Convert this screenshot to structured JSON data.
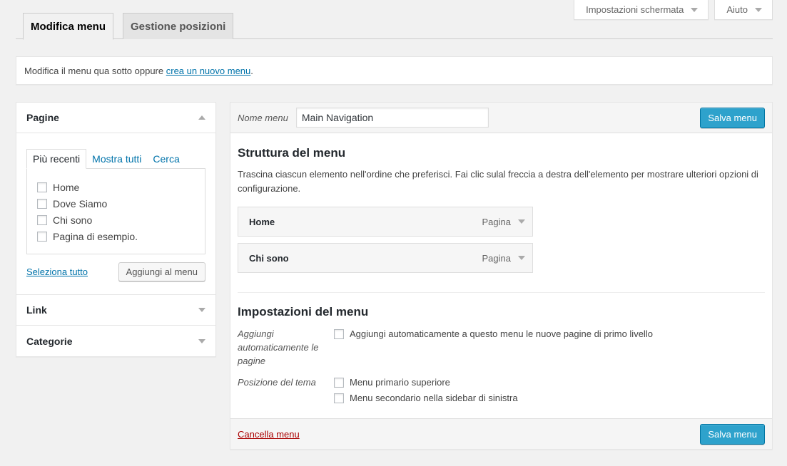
{
  "screen_options": {
    "screen_settings_label": "Impostazioni schermata",
    "help_label": "Aiuto"
  },
  "tabs": {
    "edit_menu": "Modifica menu",
    "manage_locations": "Gestione posizioni"
  },
  "notice": {
    "text": "Modifica il menu qua sotto oppure ",
    "link": "crea un nuovo menu",
    "after": "."
  },
  "sidebar": {
    "pages": {
      "title": "Pagine",
      "tabs": [
        "Più recenti",
        "Mostra tutti",
        "Cerca"
      ],
      "items": [
        "Home",
        "Dove Siamo",
        "Chi sono",
        "Pagina di esempio."
      ],
      "select_all": "Seleziona tutto",
      "add_button": "Aggiungi al menu"
    },
    "links_title": "Link",
    "categories_title": "Categorie"
  },
  "menu": {
    "name_label": "Nome menu",
    "name_value": "Main Navigation",
    "save_label": "Salva menu",
    "structure_title": "Struttura del menu",
    "structure_desc": "Trascina ciascun elemento nell'ordine che preferisci. Fai clic sulal freccia a destra dell'elemento per mostrare ulteriori opzioni di configurazione.",
    "items": [
      {
        "title": "Home",
        "type": "Pagina"
      },
      {
        "title": "Chi sono",
        "type": "Pagina"
      }
    ],
    "settings_title": "Impostazioni del menu",
    "auto_add_label": "Aggiungi automaticamente le pagine",
    "auto_add_option": "Aggiungi automaticamente a questo menu le nuove pagine di primo livello",
    "location_label": "Posizione del tema",
    "location_options": [
      "Menu primario superiore",
      "Menu secondario nella sidebar di sinistra"
    ],
    "delete_label": "Cancella menu"
  }
}
